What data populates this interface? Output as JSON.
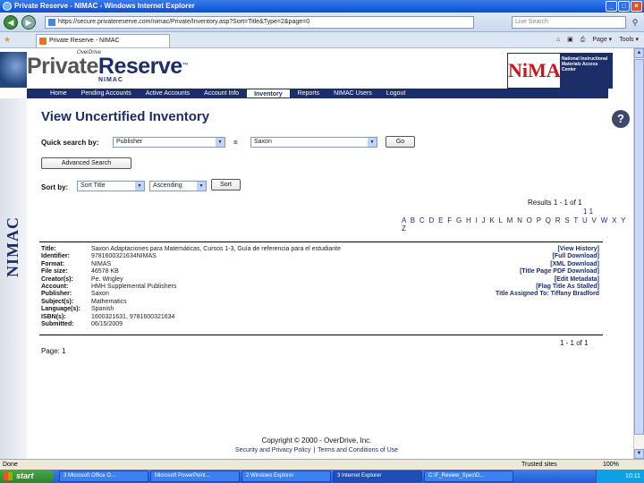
{
  "window": {
    "title": "Private Reserve - NIMAC - Windows Internet Explorer",
    "controls": [
      "_",
      "□",
      "×"
    ]
  },
  "browser": {
    "back": "◀",
    "forward": "▶",
    "address": "https://secure.privatereserve.com/nimac/Private/Inventory.asp?Sort=Title&Type=2&page=0",
    "search_placeholder": "Live Search",
    "tab_title": "Private Reserve - NIMAC",
    "commands": [
      "Page ▾",
      "Tools ▾"
    ]
  },
  "brand": {
    "overdrive": "OverDrive",
    "name_part1": "Private",
    "name_part2": "Reserve",
    "tm": "™",
    "sub": "NIMAC",
    "logo_big": "NiMAC",
    "logo_small": "National Instructional Materials Access Center",
    "vertical": "NIMAC"
  },
  "nav": {
    "items": [
      "Home",
      "Pending Accounts",
      "Active Accounts",
      "Account Info",
      "Inventory",
      "Reports",
      "NIMAC Users",
      "Logout"
    ],
    "active": "Inventory"
  },
  "page": {
    "title": "View Uncertified Inventory",
    "help": "?",
    "quick_search_label": "Quick search by:",
    "quick_search_field": "Publisher",
    "equals": "=",
    "quick_search_value": "Saxon",
    "go": "Go",
    "advanced_search": "Advanced Search",
    "sort_by_label": "Sort by:",
    "sort_field": "Sort Title",
    "sort_order": "Ascending",
    "sort_button": "Sort",
    "results": "Results 1 - 1 of 1",
    "page_numbers": "1   1",
    "alphabet": "A B C D E F G H I J K L M N O P Q R S T U V W X Y Z",
    "results_bottom": "1 - 1 of 1",
    "page_label": "Page: 1"
  },
  "record": {
    "fields": [
      {
        "k": "Title:",
        "v": "Saxon Adaptaciones para Matemáticas, Cursos 1-3, Guía de referencia para el estudiante"
      },
      {
        "k": "Identifier:",
        "v": "9781600321634NIMAS"
      },
      {
        "k": "Format:",
        "v": "NIMAS"
      },
      {
        "k": "File size:",
        "v": "46578 KB"
      },
      {
        "k": "Creator(s):",
        "v": "Pe. Wrigley"
      },
      {
        "k": "Account:",
        "v": "HMH Supplemental Publishers"
      },
      {
        "k": "Publisher:",
        "v": "Saxon"
      },
      {
        "k": "Subject(s):",
        "v": "Mathematics"
      },
      {
        "k": "Language(s):",
        "v": "Spanish"
      },
      {
        "k": "ISBN(s):",
        "v": "1600321631, 9781600321634"
      },
      {
        "k": "Submitted:",
        "v": "06/15/2009"
      }
    ],
    "actions": [
      "[View History]",
      "[Full Download]",
      "[XML Download]",
      "[Title Page PDF Download]",
      "[Edit Metadata]",
      "[Flag Title As Stalled]",
      "Title Assigned To: Tiffany Bradford"
    ]
  },
  "footer": {
    "copyright": "Copyright © 2000 - OverDrive, Inc.",
    "privacy": "Security and Privacy Policy",
    "sep": "|",
    "terms": "Terms and Conditions of Use"
  },
  "status": {
    "done": "Done",
    "zone": "Trusted sites",
    "zoom": "100%"
  },
  "taskbar": {
    "start": "start",
    "tasks": [
      "3 Microsoft Office O...",
      "Microsoft PowerPoint...",
      "2 Windows Explorer",
      "3 Internet Explorer",
      "C:\\F_Review_Spec\\D..."
    ],
    "active_index": 3,
    "clock": "10:11"
  }
}
